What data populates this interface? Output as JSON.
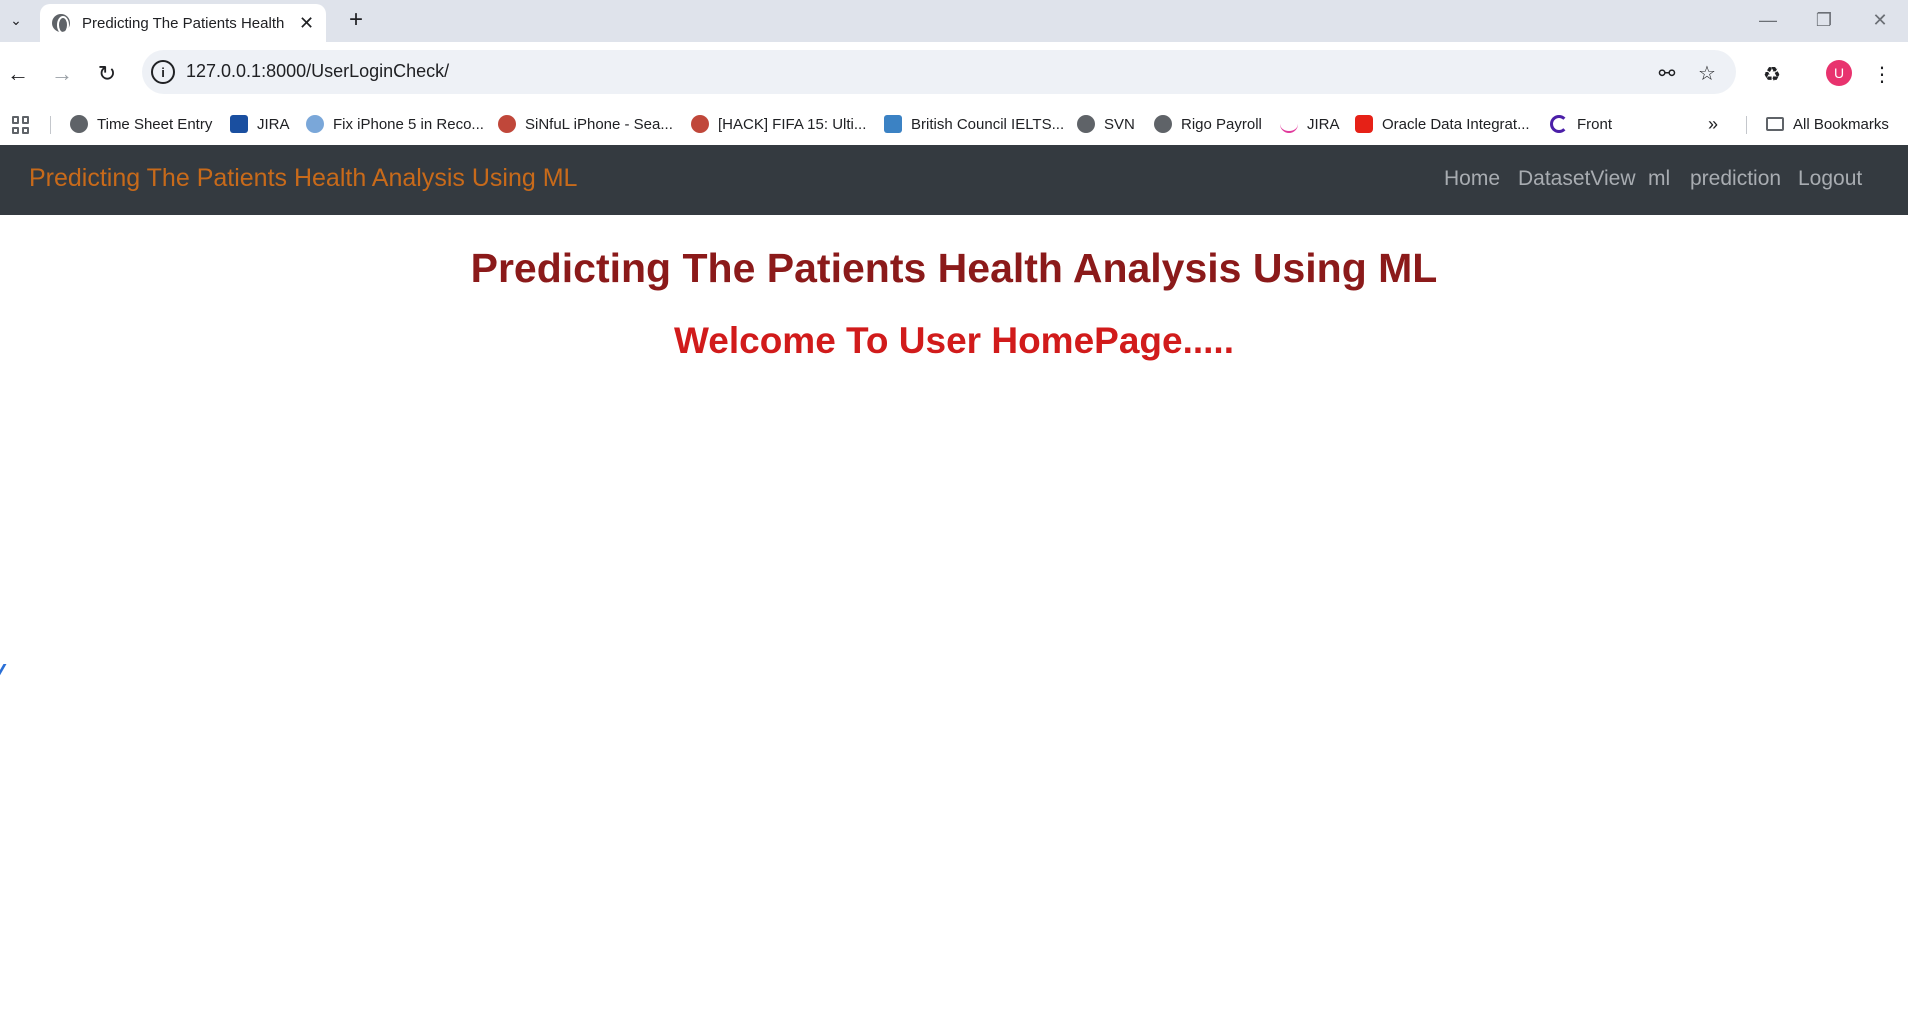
{
  "browser": {
    "tab_title": "Predicting The Patients Health Analysis Using ML",
    "url": "127.0.0.1:8000/UserLoginCheck/",
    "avatar_letter": "U",
    "bookmarks": [
      {
        "label": "Time Sheet Entry",
        "icon": "globe-icon",
        "color": "#5f6368"
      },
      {
        "label": "JIRA",
        "icon": "jira-icon",
        "color": "#1a4fa0"
      },
      {
        "label": "Fix iPhone 5 in Reco...",
        "icon": "apple-drop-icon",
        "color": "#7aa7d9"
      },
      {
        "label": "SiNfuL iPhone - Sea...",
        "icon": "biohazard-icon",
        "color": "#c0473a"
      },
      {
        "label": "[HACK] FIFA 15: Ulti...",
        "icon": "biohazard-icon",
        "color": "#c0473a"
      },
      {
        "label": "British Council IELTS...",
        "icon": "ors-icon",
        "color": "#3b82c4"
      },
      {
        "label": "SVN",
        "icon": "globe-icon",
        "color": "#5f6368"
      },
      {
        "label": "Rigo Payroll",
        "icon": "globe-icon",
        "color": "#5f6368"
      },
      {
        "label": "JIRA",
        "icon": "curve-icon",
        "color": "#e0399b"
      },
      {
        "label": "Oracle Data Integrat...",
        "icon": "youtube-icon",
        "color": "#e62117"
      },
      {
        "label": "Front",
        "icon": "front-icon",
        "color": "#4b1fa8"
      }
    ],
    "all_bookmarks_label": "All Bookmarks"
  },
  "navbar": {
    "brand": "Predicting The Patients Health Analysis Using ML",
    "links": [
      "Home",
      "DatasetView",
      "ml",
      "prediction",
      "Logout"
    ]
  },
  "main": {
    "title": "Predicting The Patients Health Analysis Using ML",
    "subtitle": "Welcome To User HomePage....."
  }
}
